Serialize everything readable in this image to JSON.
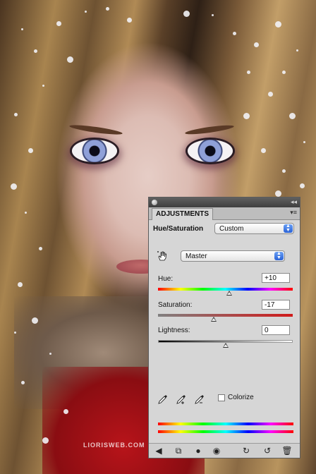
{
  "watermark": "LIORISWEB.COM",
  "panel": {
    "tab_label": "ADJUSTMENTS",
    "adjustment_title": "Hue/Saturation",
    "preset": "Custom",
    "channel": "Master",
    "hue": {
      "label": "Hue:",
      "value": "+10",
      "level": 10,
      "min": -180,
      "max": 180
    },
    "saturation": {
      "label": "Saturation:",
      "value": "-17",
      "level": -17,
      "min": -100,
      "max": 100
    },
    "lightness": {
      "label": "Lightness:",
      "value": "0",
      "level": 0,
      "min": -100,
      "max": 100
    },
    "colorize_label": "Colorize",
    "colorize_checked": false,
    "icons": {
      "hand": "on-image-adjust-icon",
      "eyedroppers": [
        "eyedropper-icon",
        "eyedropper-add-icon",
        "eyedropper-subtract-icon"
      ],
      "footer": [
        "back-arrow-icon",
        "clip-to-layer-icon",
        "layer-mask-icon",
        "visibility-eye-icon",
        "previous-state-icon",
        "reset-icon",
        "trash-icon"
      ]
    },
    "colors": {
      "panel_bg": "#d6d6d6",
      "select_arrow": "#2a62d6"
    }
  }
}
